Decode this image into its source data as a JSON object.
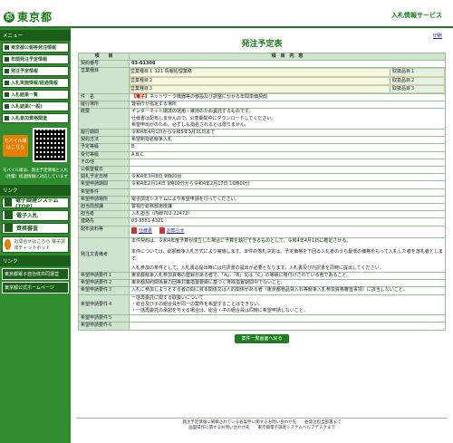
{
  "header": {
    "logo_mark": "都",
    "logo_text": "東京都",
    "service_title": "入札情報サービス"
  },
  "sidebar": {
    "menu_head": "メニュー",
    "items": [
      "東京都公報等発注情報",
      "年間発注予定情報",
      "発注予定情報",
      "入札実施情報/経過情報",
      "入札結果一覧",
      "入札結果(一般)",
      "入札参加資格関連"
    ],
    "mobile_badge": "モバイル版はこちら",
    "mobile_note": "モバイル版は、発注予定情報と入札（見積）経過情報に対応しています",
    "related_head": "リンク",
    "big_buttons": [
      "電子調達システム(TOP)",
      "電子入札",
      "資格審査"
    ],
    "help_button": "お問合せはこちら 電子調達チャットボット",
    "links_head": "リンク",
    "links": [
      "東京都電子自治体共同運営",
      "東京都公式ホームページ"
    ]
  },
  "main": {
    "print_link": "印刷",
    "title": "発注予定表",
    "col_item": "項　　目",
    "col_content": "項　目　内　容",
    "rows": {
      "contract_no_label": "契約番号",
      "contract_no": "03-61308",
      "business_type_label": "営業種目",
      "business_types": [
        {
          "name": "営業種目１ 121 情報処理業務",
          "class": "取扱品目１"
        },
        {
          "name": "営業種目２",
          "class": "取扱品目２"
        },
        {
          "name": "営業種目３",
          "class": "取扱品目３"
        }
      ],
      "subject_label": "件　名",
      "subject_tag": "【電子】",
      "subject": "ネットワーク機器等の移設及び調整にかかる年間単価契約",
      "place_label": "履行場所",
      "place": "警視庁が指定する場所",
      "summary_label": "概要",
      "summary_lines": [
        "インターネット環境の運用・維持のため委託するものです。",
        "仕様書は配布しませんので、公表期間中にダウンロードしてください。",
        "希望申出がのため、必ずしも指名されるとは限りません。"
      ],
      "period_label": "履行期間",
      "period": "令和4年4月1日から令和5年3月31日まで",
      "method_label": "契約方法",
      "method": "希望制指名競争入札",
      "grade_label": "予定等級",
      "grade": "B",
      "accept_grade_label": "受付等級",
      "accept_grade": "A,B,C",
      "other_label": "その他",
      "other": "",
      "public_date_label": "公報登載日",
      "public_date": "",
      "open_date_label": "開札予定日時",
      "open_date": "令和4年3月8日 9時00分",
      "apply_period_label": "希望申請期間",
      "apply_period": "令和4年2月14日 9時00分から令和4年2月17日 16時00分",
      "apply_cond_label": "希望条件",
      "apply_cond": "",
      "apply_method_label": "希望申請場所",
      "apply_method": "電子調達システムにより希望申請を行ってください。",
      "contact_org_label": "担当局部課",
      "contact_org": "警視庁総務部用度課",
      "contact_person_label": "担当者",
      "contact_person": "入札担当（内線702-22472）",
      "contact_tel_label": "連絡先",
      "contact_tel": "03-3581-4321",
      "attach_label": "配布資料等",
      "attach_1": "仕様書",
      "attach_2": "お知らせ",
      "notes_label": "発注文書備考",
      "notes_1": "本件契約は、令和4年度予算が成立した場合に予算を執行できるものとして、令和4年4月1日に確定させる。",
      "notes_2": "本件については、総額競争入札方式により実施します。本件の落札決定は、予定価格を下回る入札者のうち最低の価格をもって入札した者を落札者とします。",
      "notes_3": "入札参加の条件として、入札書の提出時には内訳書の提出が必要となります。入札書及び内訳書を同時に提出してください。",
      "req1_label": "希望申請要件１",
      "req1": "東京都競争入札参加資格の登録がある者で、「A」、「B」又は「C」の等級に格付けされている者であること。",
      "req2_label": "希望申請要件２",
      "req2": "東京都契約関係暴力団等対策措置要綱に基づく排除措置期間中でないこと。",
      "req3_label": "希望申請要件３",
      "req3": "入札に参加しようとする者の間に資本関係又は人的関係がある者（東京都物品買入れ等競争入札参加資格審査事項）に該当しないこと。",
      "req4_label": "希望申請要件４",
      "req4_lines": [
        "一括再委託に関する取扱いについて",
        "・総合及び子の組合員が同一の案件を希望することはできない。",
        "・一括再委託の承認を与える場合は、総合・子の組合員は同時に希望申請しないこと。"
      ],
      "req5_label": "希望申請要件５",
      "req5": "",
      "req6_label": "希望申請要件６",
      "req6": ""
    },
    "back_button": "案件一覧画面へ戻る"
  },
  "footer": {
    "line1": "発注予定情報に掲載されている各案件に関するお問い合わせ先　　各発注担当部署まで",
    "line2": "画面操作に関するお問い合わせ先　　東京都電子調達システムヘルプデスクまで"
  }
}
